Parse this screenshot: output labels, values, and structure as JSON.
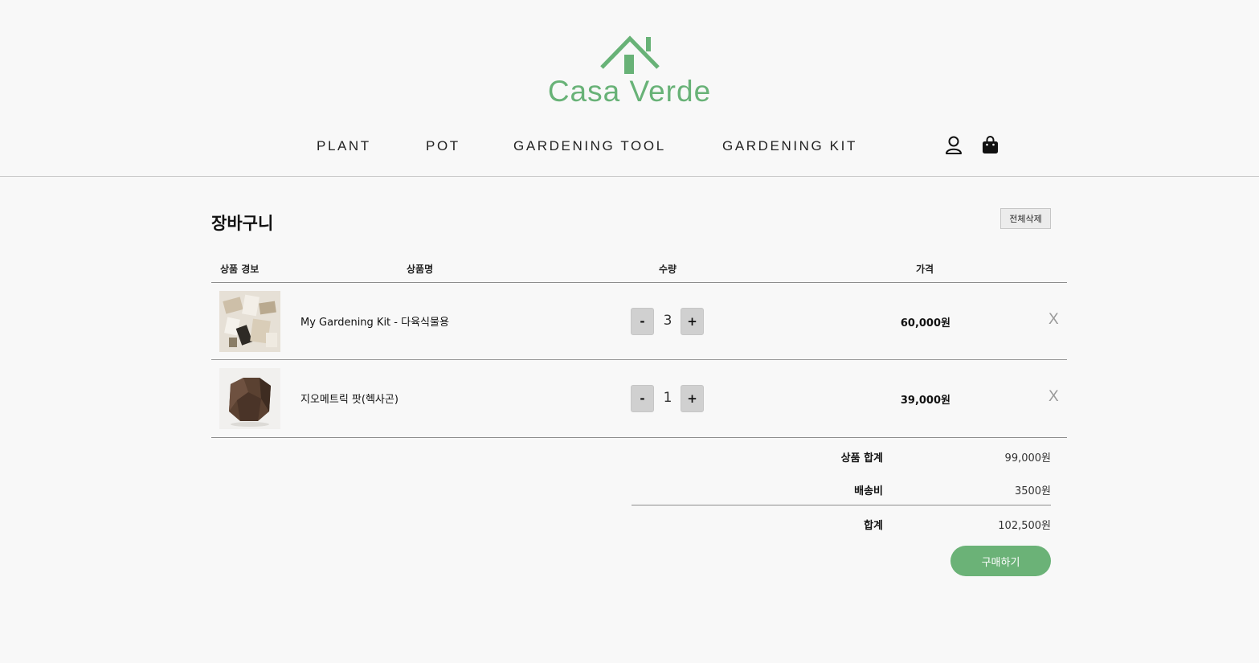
{
  "brand": {
    "name": "Casa Verde",
    "color": "#68b277",
    "icon": "house-icon"
  },
  "nav": {
    "items": [
      {
        "label": "PLANT"
      },
      {
        "label": "POT"
      },
      {
        "label": "GARDENING TOOL"
      },
      {
        "label": "GARDENING KIT"
      }
    ],
    "icons": [
      "user-icon",
      "shopping-bag-icon"
    ]
  },
  "cart": {
    "title": "장바구니",
    "delete_all_label": "전체삭제",
    "columns": {
      "info": "상품 경보",
      "name": "상품명",
      "qty": "수량",
      "price": "가격"
    },
    "items": [
      {
        "name": "My Gardening Kit - 다육식물용",
        "quantity": "3",
        "price": "60,000원",
        "remove": "X",
        "minus": "-",
        "plus": "+"
      },
      {
        "name": "지오메트릭 팟(헥사곤)",
        "quantity": "1",
        "price": "39,000원",
        "remove": "X",
        "minus": "-",
        "plus": "+"
      }
    ],
    "summary": {
      "subtotal_label": "상품 합계",
      "subtotal": "99,000원",
      "shipping_label": "배송비",
      "shipping": "3500원",
      "total_label": "합계",
      "total": "102,500원"
    },
    "buy_label": "구매하기"
  },
  "colors": {
    "accent": "#6bb277",
    "background": "#f8f8f8"
  }
}
